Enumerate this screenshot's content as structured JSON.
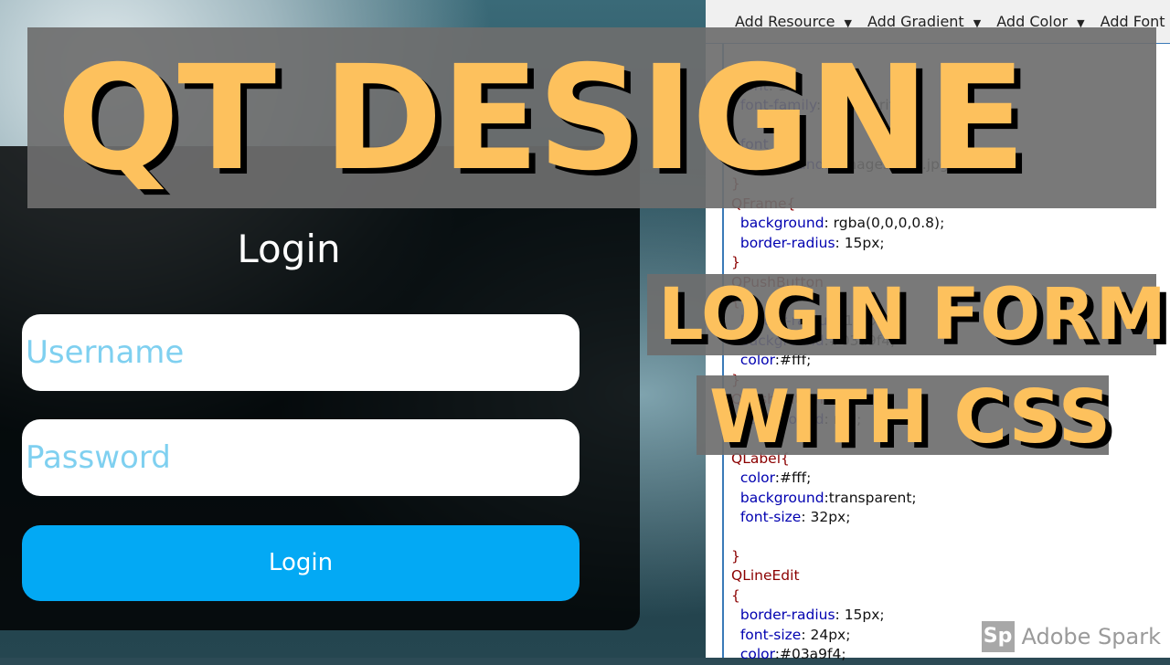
{
  "preview": {
    "title": "Login",
    "username_placeholder": "Username",
    "password_placeholder": "Password",
    "button": "Login",
    "accent": "#03a9f4"
  },
  "editor": {
    "toolbar": [
      "Add Resource",
      "Add Gradient",
      "Add Color",
      "Add Font"
    ],
    "code": [
      {
        "s": "",
        "p": "  font",
        "v": ": 16"
      },
      {
        "s": "",
        "p": "  font-family",
        "v": ": sans-serif"
      },
      {
        "s": "",
        "p": "",
        "v": ""
      },
      {
        "s": "",
        "p": "  font",
        "v": ""
      },
      {
        "s": "",
        "p": "  background",
        "v": ": (images/bg2.jpg)"
      },
      {
        "s": "}",
        "p": "",
        "v": ""
      },
      {
        "s": "QFrame{",
        "p": "",
        "v": ""
      },
      {
        "s": "",
        "p": "  background",
        "v": ": rgba(0,0,0,0.8);"
      },
      {
        "s": "",
        "p": "  border-radius",
        "v": ": 15px;"
      },
      {
        "s": "}",
        "p": "",
        "v": ""
      },
      {
        "s": "QPushButton",
        "p": "",
        "v": ""
      },
      {
        "s": "{",
        "p": "",
        "v": ""
      },
      {
        "s": "",
        "p": "  border-radius",
        "v": ": 15px;"
      },
      {
        "s": "",
        "p": "  background",
        "v": ":#03a9f4;"
      },
      {
        "s": "",
        "p": "  color",
        "v": ":#fff;"
      },
      {
        "s": "}",
        "p": "",
        "v": ""
      },
      {
        "s": "QPushButton:hover",
        "p": "",
        "v": ""
      },
      {
        "s": "",
        "p": "  background",
        "v": ": red;"
      },
      {
        "s": "}",
        "p": "",
        "v": ""
      },
      {
        "s": "QLabel{",
        "p": "",
        "v": ""
      },
      {
        "s": "",
        "p": "  color",
        "v": ":#fff;"
      },
      {
        "s": "",
        "p": "  background",
        "v": ":transparent;"
      },
      {
        "s": "",
        "p": "  font-size",
        "v": ": 32px;"
      },
      {
        "s": "",
        "p": "",
        "v": ""
      },
      {
        "s": "}",
        "p": "",
        "v": ""
      },
      {
        "s": "QLineEdit",
        "p": "",
        "v": ""
      },
      {
        "s": "{",
        "p": "",
        "v": ""
      },
      {
        "s": "",
        "p": "  border-radius",
        "v": ": 15px;"
      },
      {
        "s": "",
        "p": "  font-size",
        "v": ": 24px;"
      },
      {
        "s": "",
        "p": "  color",
        "v": ":#03a9f4;"
      }
    ]
  },
  "overlay": {
    "line1": "QT DESIGNE",
    "line2": "LOGIN FORM",
    "line3": "WITH CSS",
    "text_color": "#fdc15d"
  },
  "watermark": {
    "logo": "Sp",
    "text": "Adobe Spark"
  }
}
